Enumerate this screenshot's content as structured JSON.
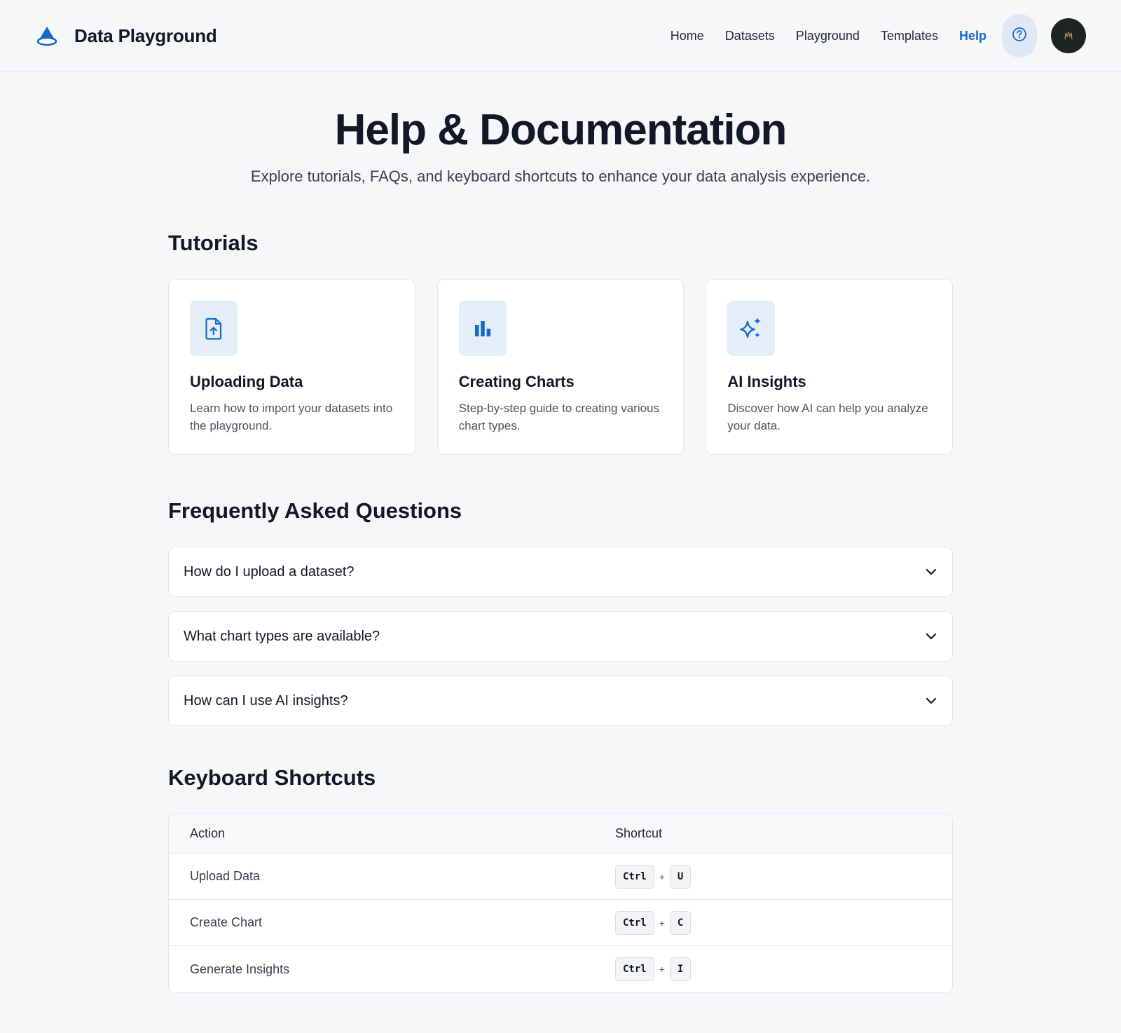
{
  "app": {
    "title": "Data Playground",
    "accent_color": "#1769c9"
  },
  "nav": {
    "items": [
      {
        "label": "Home",
        "active": false
      },
      {
        "label": "Datasets",
        "active": false
      },
      {
        "label": "Playground",
        "active": false
      },
      {
        "label": "Templates",
        "active": false
      },
      {
        "label": "Help",
        "active": true
      }
    ],
    "help_icon": "question-circle-icon",
    "avatar": "user-avatar"
  },
  "hero": {
    "title": "Help & Documentation",
    "subtitle": "Explore tutorials, FAQs, and keyboard shortcuts to enhance your data analysis experience."
  },
  "tutorials": {
    "title": "Tutorials",
    "cards": [
      {
        "icon": "file-upload-icon",
        "title": "Uploading Data",
        "description": "Learn how to import your datasets into the playground."
      },
      {
        "icon": "bar-chart-icon",
        "title": "Creating Charts",
        "description": "Step-by-step guide to creating various chart types."
      },
      {
        "icon": "sparkles-icon",
        "title": "AI Insights",
        "description": "Discover how AI can help you analyze your data."
      }
    ]
  },
  "faq": {
    "title": "Frequently Asked Questions",
    "items": [
      {
        "question": "How do I upload a dataset?"
      },
      {
        "question": "What chart types are available?"
      },
      {
        "question": "How can I use AI insights?"
      }
    ]
  },
  "shortcuts": {
    "title": "Keyboard Shortcuts",
    "headers": {
      "action": "Action",
      "shortcut": "Shortcut"
    },
    "rows": [
      {
        "action": "Upload Data",
        "keys": [
          "Ctrl",
          "U"
        ],
        "separator": "+"
      },
      {
        "action": "Create Chart",
        "keys": [
          "Ctrl",
          "C"
        ],
        "separator": "+"
      },
      {
        "action": "Generate Insights",
        "keys": [
          "Ctrl",
          "I"
        ],
        "separator": "+"
      }
    ]
  }
}
